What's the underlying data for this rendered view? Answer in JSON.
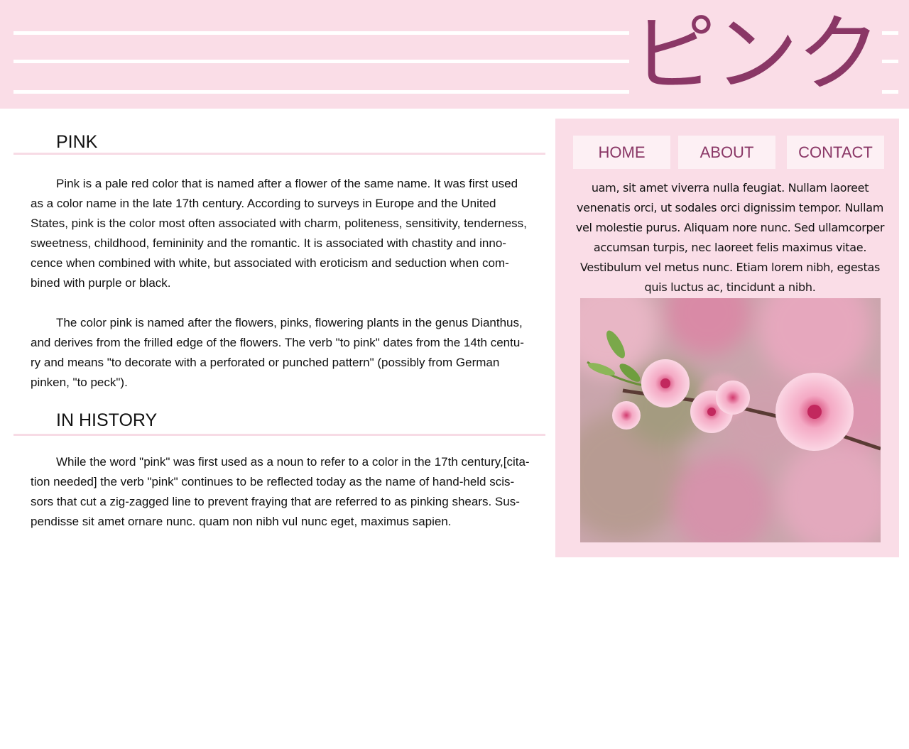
{
  "header": {
    "title": "ピンク"
  },
  "main": {
    "sections": [
      {
        "heading": "PINK",
        "paragraphs": [
          "Pink is a pale red color that is named after a flower of the same name. It was first used as a color name in the late 17th century. According to surveys in Europe and the United States, pink is the color most often associated with charm, politeness, sensitivity, tenderness, sweetness, childhood, femininity and the romantic. It is associated with chastity and inno-cence when combined with white, but associated with eroticism and seduction when com-bined with purple or black.",
          "The color pink is named after the flowers, pinks, flowering plants in the genus Dianthus, and derives from the frilled edge of the flowers. The verb \"to pink\" dates from the 14th centu-ry and means \"to decorate with a perforated or punched pattern\" (possibly from German pinken, \"to peck\")."
        ]
      },
      {
        "heading": "IN HISTORY",
        "paragraphs": [
          "While the word \"pink\" was first used as a noun to refer to a color in the 17th century,[cita-tion needed] the verb \"pink\" continues to be reflected today as the name of hand-held scis-sors that cut a zig-zagged line to prevent fraying that are referred to as pinking shears. Sus-pendisse sit amet ornare nunc. quam non nibh vul nunc eget, maximus sapien."
        ]
      }
    ]
  },
  "sidebar": {
    "nav": [
      {
        "label": "HOME"
      },
      {
        "label": "ABOUT"
      },
      {
        "label": "CONTACT"
      }
    ],
    "text": "uam, sit amet viverra nulla feugiat. Nullam laoreet venenatis orci, ut sodales orci dignissim tempor. Nullam vel molestie purus. Aliquam nore nunc. Sed ullamcorper accumsan turpis, nec laoreet felis maximus vitae. Vestibulum vel metus nunc. Etiam lorem nibh, egestas quis luctus ac, tincidunt a nibh."
  },
  "colors": {
    "header_bg": "#fadde7",
    "accent": "#8a3766",
    "button_bg": "#fdf0f4",
    "rule": "#f7dbe5"
  }
}
